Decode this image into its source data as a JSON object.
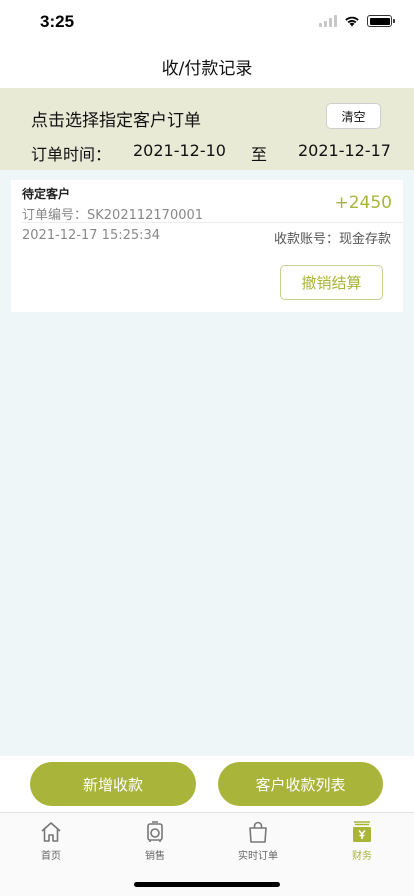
{
  "status_bar": {
    "time": "3:25"
  },
  "nav": {
    "title": "收/付款记录"
  },
  "filter": {
    "prompt": "点击选择指定客户订单",
    "clear_label": "清空",
    "date_label": "订单时间：",
    "start_date": "2021-12-10",
    "separator": "至",
    "end_date": "2021-12-17"
  },
  "records": [
    {
      "customer": "待定客户",
      "order_no": "订单编号：SK202112170001",
      "amount": "+2450",
      "time": "2021-12-17 15:25:34",
      "account": "收款账号：现金存款",
      "revoke_label": "撤销结算"
    }
  ],
  "actions": {
    "add_label": "新增收款",
    "list_label": "客户收款列表"
  },
  "tabs": [
    {
      "label": "首页",
      "icon": "home-icon",
      "active": false
    },
    {
      "label": "销售",
      "icon": "sales-icon",
      "active": false
    },
    {
      "label": "实时订单",
      "icon": "shopping-bag-icon",
      "active": false
    },
    {
      "label": "财务",
      "icon": "finance-icon",
      "active": true
    }
  ],
  "colors": {
    "accent": "#a9b53a",
    "filter_bg": "#e8ead6",
    "page_bg": "#eef6f8"
  }
}
